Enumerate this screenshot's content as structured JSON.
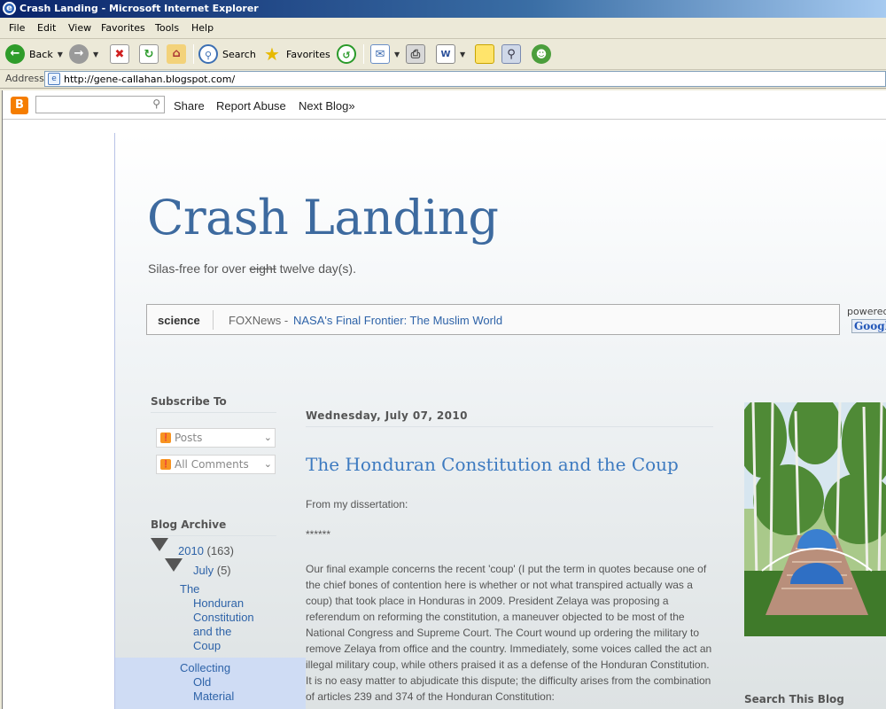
{
  "window": {
    "title": "Crash Landing - Microsoft Internet Explorer"
  },
  "menu": [
    "File",
    "Edit",
    "View",
    "Favorites",
    "Tools",
    "Help"
  ],
  "toolbar": {
    "back": "Back",
    "search": "Search",
    "favorites": "Favorites"
  },
  "address": {
    "label": "Address",
    "url": "http://gene-callahan.blogspot.com/"
  },
  "navbar": {
    "share": "Share",
    "report_abuse": "Report Abuse",
    "next_blog": "Next Blog»"
  },
  "blog": {
    "title": "Crash Landing",
    "desc_before": "Silas-free for over ",
    "desc_strike": "eight",
    "desc_after": " twelve day(s)."
  },
  "news": {
    "topic": "science",
    "source": "FOXNews -",
    "headline": "NASA's Final Frontier: The Muslim World",
    "powered": "powered",
    "google": "Google"
  },
  "sidebar": {
    "subscribe_heading": "Subscribe To",
    "feeds": [
      "Posts",
      "All Comments"
    ],
    "archive_heading": "Blog Archive",
    "year": "2010",
    "year_count": "(163)",
    "month": "July",
    "month_count": "(5)",
    "post_link_lines": [
      "The",
      "Honduran",
      "Constitution",
      "and the",
      "Coup"
    ],
    "post_link2_lines": [
      "Collecting",
      "Old",
      "Material"
    ]
  },
  "post": {
    "date": "Wednesday, July 07, 2010",
    "title": "The Honduran Constitution and the Coup",
    "intro": "From my dissertation:",
    "stars": "******",
    "body": "Our final example concerns the recent 'coup' (I put the term in quotes because one of the chief bones of contention here is whether or not what transpired actually was a coup) that took place in Honduras in 2009. President Zelaya was proposing a referendum on reforming the constitution, a maneuver objected to be most of the National Congress and Supreme Court. The Court wound up ordering the military to remove Zelaya from office and the country. Immediately, some voices called the act an illegal military coup, while others praised it as a defense of the Honduran Constitution. It is no easy matter to abjudicate this dispute; the difficulty arises from the combination of articles 239 and 374 of the Honduran Constitution:"
  },
  "right": {
    "search_heading": "Search This Blog"
  },
  "colors": {
    "blog_title": "#3d6a9f",
    "link": "#2e63a8",
    "post_title": "#3d7ac0"
  }
}
